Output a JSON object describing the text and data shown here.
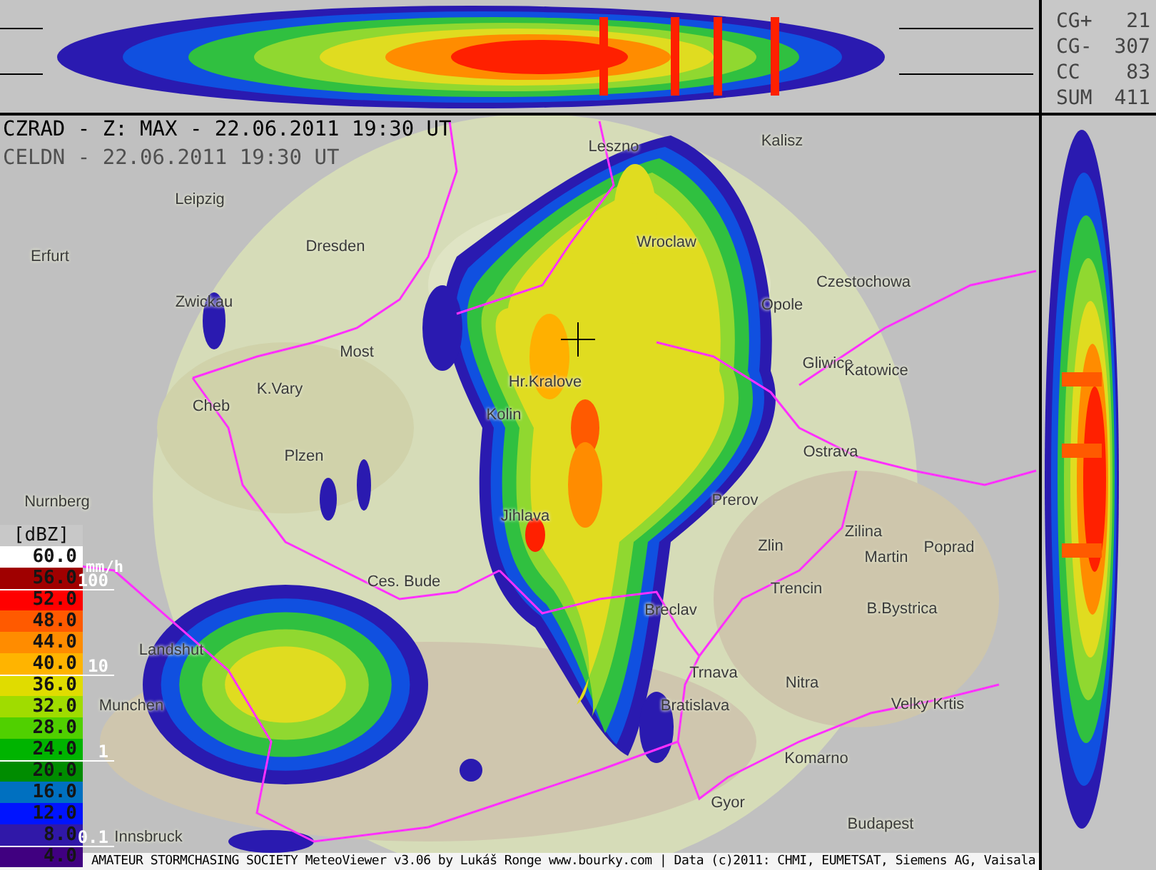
{
  "header": {
    "product": "CZRAD - Z: MAX - 22.06.2011 19:30 UT",
    "lightning": "CELDN - 22.06.2011 19:30 UT"
  },
  "lightning_stats": [
    {
      "label": "CG+",
      "value": "21"
    },
    {
      "label": "CG-",
      "value": "307"
    },
    {
      "label": "CC",
      "value": "83"
    },
    {
      "label": "SUM",
      "value": "411"
    }
  ],
  "legend": {
    "unit": "[dBZ]",
    "rain_unit": "mm/h",
    "levels": [
      {
        "value": "60.0",
        "color": "#ffffff"
      },
      {
        "value": "56.0",
        "color": "#a00000"
      },
      {
        "value": "52.0",
        "color": "#ff0000"
      },
      {
        "value": "48.0",
        "color": "#ff5a00"
      },
      {
        "value": "44.0",
        "color": "#ff8c00"
      },
      {
        "value": "40.0",
        "color": "#ffb400"
      },
      {
        "value": "36.0",
        "color": "#e0dc00"
      },
      {
        "value": "32.0",
        "color": "#a0dc00"
      },
      {
        "value": "28.0",
        "color": "#50d000"
      },
      {
        "value": "24.0",
        "color": "#00b400"
      },
      {
        "value": "20.0",
        "color": "#008c00"
      },
      {
        "value": "16.0",
        "color": "#0070c0"
      },
      {
        "value": "12.0",
        "color": "#0014ff"
      },
      {
        "value": "8.0",
        "color": "#3018a8"
      },
      {
        "value": "4.0",
        "color": "#400080"
      }
    ],
    "rain_marks": [
      "100",
      "10",
      "1",
      "0.1"
    ]
  },
  "cities": [
    {
      "name": "Leszno"
    },
    {
      "name": "Kalisz"
    },
    {
      "name": "Leipzig"
    },
    {
      "name": "Wroclaw"
    },
    {
      "name": "Erfurt"
    },
    {
      "name": "Dresden"
    },
    {
      "name": "Czestochowa"
    },
    {
      "name": "Zwickau"
    },
    {
      "name": "Opole"
    },
    {
      "name": "Most"
    },
    {
      "name": "Gliwice"
    },
    {
      "name": "Katowice"
    },
    {
      "name": "Cheb"
    },
    {
      "name": "K.Vary"
    },
    {
      "name": "Hr.Kralove"
    },
    {
      "name": "Kolin"
    },
    {
      "name": "Plzen"
    },
    {
      "name": "Ostrava"
    },
    {
      "name": "Nurnberg"
    },
    {
      "name": "Prerov"
    },
    {
      "name": "Jihlava"
    },
    {
      "name": "Zlin"
    },
    {
      "name": "Zilina"
    },
    {
      "name": "Martin"
    },
    {
      "name": "Poprad"
    },
    {
      "name": "Ces. Bude"
    },
    {
      "name": "Trencin"
    },
    {
      "name": "Breclav"
    },
    {
      "name": "B.Bystrica"
    },
    {
      "name": "Landshut"
    },
    {
      "name": "Trnava"
    },
    {
      "name": "Nitra"
    },
    {
      "name": "Munchen"
    },
    {
      "name": "Bratislava"
    },
    {
      "name": "Velky Krtis"
    },
    {
      "name": "Komarno"
    },
    {
      "name": "Gyor"
    },
    {
      "name": "Budapest"
    },
    {
      "name": "Innsbruck"
    }
  ],
  "footer": "AMATEUR STORMCHASING SOCIETY MeteoViewer v3.06 by Lukáš Ronge www.bourky.com | Data (c)2011: CHMI, EUMETSAT, Siemens AG, Vaisala"
}
